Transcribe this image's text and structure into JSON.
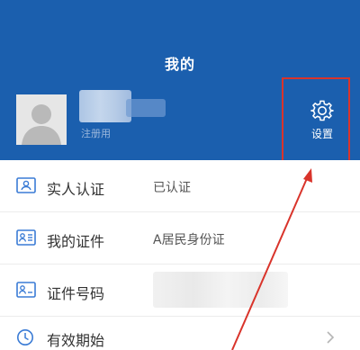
{
  "header": {
    "title": "我的",
    "username": "注册用",
    "settings_label": "设置"
  },
  "rows": [
    {
      "label": "实人认证",
      "value": "已认证",
      "icon": "person-card-icon"
    },
    {
      "label": "我的证件",
      "value": "A居民身份证",
      "icon": "id-card-icon"
    },
    {
      "label": "证件号码",
      "value": "",
      "icon": "id-number-card-icon"
    },
    {
      "label": "有效期始",
      "value": "",
      "icon": "clock-icon"
    }
  ],
  "colors": {
    "header_bg": "#1b5fae",
    "highlight": "#d9342b",
    "icon": "#3a7bd5"
  }
}
